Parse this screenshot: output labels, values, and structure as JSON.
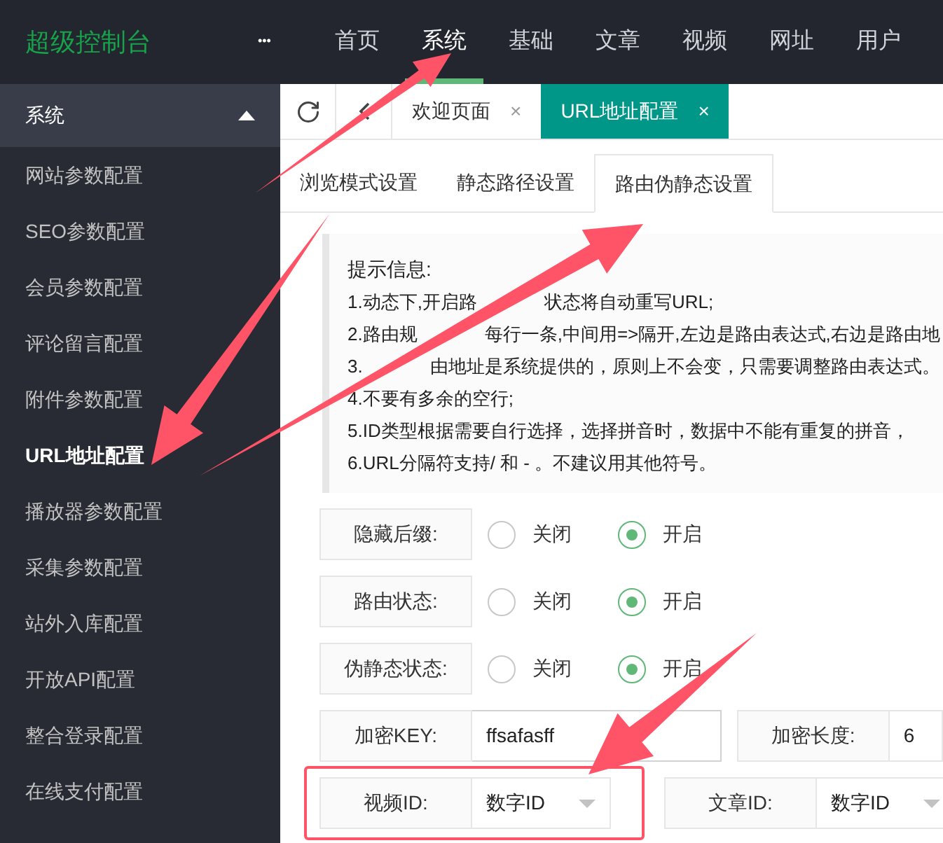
{
  "header": {
    "logo": "超级控制台",
    "more": "•••",
    "nav": [
      {
        "label": "首页",
        "selected": false
      },
      {
        "label": "系统",
        "selected": true
      },
      {
        "label": "基础",
        "selected": false
      },
      {
        "label": "文章",
        "selected": false
      },
      {
        "label": "视频",
        "selected": false
      },
      {
        "label": "网址",
        "selected": false
      },
      {
        "label": "用户",
        "selected": false
      }
    ]
  },
  "sidebar": {
    "group": {
      "label": "系统",
      "expanded": true
    },
    "items": [
      {
        "label": "网站参数配置",
        "selected": false
      },
      {
        "label": "SEO参数配置",
        "selected": false
      },
      {
        "label": "会员参数配置",
        "selected": false
      },
      {
        "label": "评论留言配置",
        "selected": false
      },
      {
        "label": "附件参数配置",
        "selected": false
      },
      {
        "label": "URL地址配置",
        "selected": true
      },
      {
        "label": "播放器参数配置",
        "selected": false
      },
      {
        "label": "采集参数配置",
        "selected": false
      },
      {
        "label": "站外入库配置",
        "selected": false
      },
      {
        "label": "开放API配置",
        "selected": false
      },
      {
        "label": "整合登录配置",
        "selected": false
      },
      {
        "label": "在线支付配置",
        "selected": false
      }
    ]
  },
  "page_tabs": [
    {
      "label": "欢迎页面",
      "selected": false,
      "close": "×"
    },
    {
      "label": "URL地址配置",
      "selected": true,
      "close": "×"
    }
  ],
  "sub_tabs": [
    {
      "label": "浏览模式设置",
      "selected": false
    },
    {
      "label": "静态路径设置",
      "selected": false
    },
    {
      "label": "路由伪静态设置",
      "selected": true
    }
  ],
  "tips": {
    "title": "提示信息:",
    "lines": [
      {
        "parts": [
          "1.动态下,开启路",
          "状态将自动重写URL;"
        ]
      },
      {
        "parts": [
          "2.路由规",
          "每行一条,中间用=>隔开,左边是路由表达式,右边是路由地"
        ]
      },
      {
        "parts": [
          "3.",
          "由地址是系统提供的，原则上不会变，只需要调整路由表达式。"
        ]
      },
      {
        "parts": [
          "4.不要有多余的空行;"
        ]
      },
      {
        "parts": [
          "5.ID类型根据需要自行选择，选择拼音时，数据中不能有重复的拼音，"
        ]
      },
      {
        "parts": [
          "6.URL分隔符支持/ 和 - 。不建议用其他符号。"
        ]
      }
    ]
  },
  "form": {
    "radios": [
      {
        "label": "隐藏后缀:",
        "options": [
          {
            "label": "关闭",
            "selected": false
          },
          {
            "label": "开启",
            "selected": true
          }
        ]
      },
      {
        "label": "路由状态:",
        "options": [
          {
            "label": "关闭",
            "selected": false
          },
          {
            "label": "开启",
            "selected": true
          }
        ]
      },
      {
        "label": "伪静态状态:",
        "options": [
          {
            "label": "关闭",
            "selected": false
          },
          {
            "label": "开启",
            "selected": true
          }
        ]
      }
    ],
    "key": {
      "label": "加密KEY:",
      "value": "ffsafasff"
    },
    "length": {
      "label": "加密长度:",
      "value": "6"
    },
    "selects": [
      {
        "label": "视频ID:",
        "value": "数字ID",
        "highlighted": true
      },
      {
        "label": "文章ID:",
        "value": "数字ID",
        "highlighted": false
      }
    ]
  }
}
